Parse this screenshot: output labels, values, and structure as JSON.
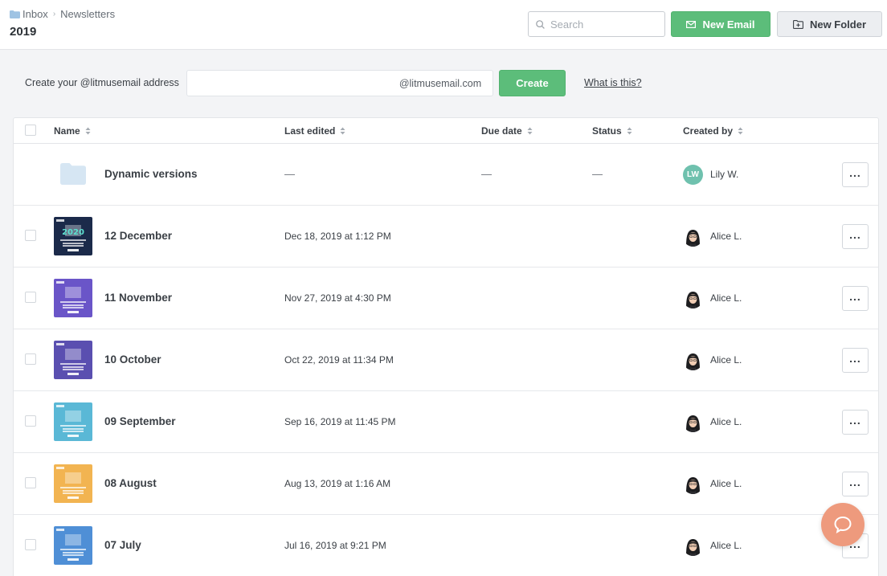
{
  "header": {
    "breadcrumb": {
      "root": "Inbox",
      "current": "Newsletters"
    },
    "title": "2019",
    "search_placeholder": "Search",
    "new_email_label": "New Email",
    "new_folder_label": "New Folder"
  },
  "create_address": {
    "label": "Create your @litmusemail address",
    "input_value": "",
    "domain_suffix": "@litmusemail.com",
    "create_label": "Create",
    "help_link": "What is this?"
  },
  "table": {
    "columns": {
      "name": "Name",
      "last_edited": "Last edited",
      "due_date": "Due date",
      "status": "Status",
      "created_by": "Created by"
    },
    "folder_row": {
      "name": "Dynamic versions",
      "last_edited": "—",
      "due_date": "—",
      "status": "—",
      "creator_initials": "LW",
      "creator": "Lily W."
    },
    "rows": [
      {
        "name": "12 December",
        "last_edited": "Dec 18, 2019 at 1:12 PM",
        "creator": "Alice L.",
        "thumb_color": "#1b2a4a",
        "thumb_text": "2020"
      },
      {
        "name": "11 November",
        "last_edited": "Nov 27, 2019 at 4:30 PM",
        "creator": "Alice L.",
        "thumb_color": "#6a55c8",
        "thumb_text": ""
      },
      {
        "name": "10 October",
        "last_edited": "Oct 22, 2019 at 11:34 PM",
        "creator": "Alice L.",
        "thumb_color": "#5a4fb0",
        "thumb_text": ""
      },
      {
        "name": "09 September",
        "last_edited": "Sep 16, 2019 at 11:45 PM",
        "creator": "Alice L.",
        "thumb_color": "#5ab8d6",
        "thumb_text": ""
      },
      {
        "name": "08 August",
        "last_edited": "Aug 13, 2019 at 1:16 AM",
        "creator": "Alice L.",
        "thumb_color": "#f2b451",
        "thumb_text": ""
      },
      {
        "name": "07 July",
        "last_edited": "Jul 16, 2019 at 9:21 PM",
        "creator": "Alice L.",
        "thumb_color": "#4f8fd6",
        "thumb_text": ""
      }
    ]
  },
  "colors": {
    "accent_green": "#5cbd7a",
    "help_fab": "#ee9a7d",
    "folder_icon": "#d6e6f3",
    "avatar_initials_bg": "#6fc1ae"
  }
}
